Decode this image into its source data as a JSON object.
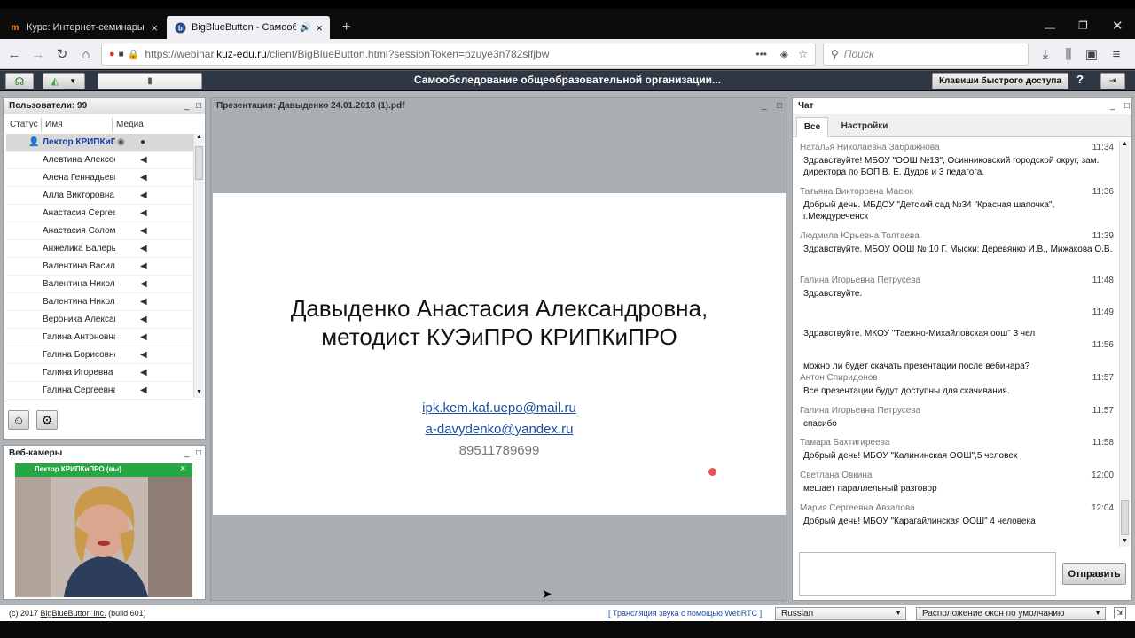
{
  "browser": {
    "tabs": [
      {
        "label": "Курс: Интернет-семинары КР",
        "icon": "moodle-icon",
        "active": false
      },
      {
        "label": "BigBlueButton - Самообсл",
        "icon": "bigbluebutton-icon",
        "active": true
      }
    ],
    "url_prefix": "https://webinar.",
    "url_domain": "kuz-edu.ru",
    "url_path": "/client/BigBlueButton.html?sessionToken=pzuye3n782slfjbw",
    "search_placeholder": "Поиск"
  },
  "app": {
    "title": "Самообследование общеобразовательной организации...",
    "shortcut_button": "Клавиши быстрого доступа",
    "help": "?"
  },
  "users": {
    "header": "Пользователи: 99",
    "columns": [
      "Статус",
      "Имя",
      "Медиа"
    ],
    "rows": [
      {
        "name": "Лектор КРИПКиПРО",
        "presenter": true
      },
      {
        "name": "Алевтина Алексеевна"
      },
      {
        "name": "Алена Геннадьевна"
      },
      {
        "name": "Алла Викторовна"
      },
      {
        "name": "Анастасия Сергеевна"
      },
      {
        "name": "Анастасия Соломоновна"
      },
      {
        "name": "Анжелика Валерьевна"
      },
      {
        "name": "Валентина Васильевна"
      },
      {
        "name": "Валентина Николаевна"
      },
      {
        "name": "Валентина Николаевна"
      },
      {
        "name": "Вероника Александровна"
      },
      {
        "name": "Галина Антоновна"
      },
      {
        "name": "Галина Борисовна"
      },
      {
        "name": "Галина Игоревна"
      },
      {
        "name": "Галина Сергеевна"
      }
    ]
  },
  "webcams": {
    "header": "Веб-камеры",
    "cam_label": "Лектор КРИПКиПРО (вы)"
  },
  "presentation": {
    "header": "Презентация: Давыденко 24.01.2018 (1).pdf",
    "line1": "Давыденко Анастасия Александровна,",
    "line2": "методист КУЭиПРО КРИПКиПРО",
    "email1": "ipk.kem.kaf.uepo@mail.ru",
    "email2": "a-davydenko@yandex.ru",
    "phone": "89511789699"
  },
  "chat": {
    "header": "Чат",
    "tabs": [
      "Все",
      "Настройки"
    ],
    "messages": [
      {
        "who": "Наталья Николаевна Забражнова",
        "time": "11:34",
        "text": "Здравствуйте! МБОУ \"ООШ №13\", Осинниковский городской округ, зам. директора по БОП В. Е. Дудов и 3 педагога."
      },
      {
        "who": "Татьяна Викторовна Масюк",
        "time": "11:36",
        "text": "Добрый день. МБДОУ \"Детский сад №34 \"Красная шапочка\", г.Междуреченск"
      },
      {
        "who": "Людмила Юрьевна Толтаева",
        "time": "11:39",
        "text": "Здравствуйте. МБОУ ООШ № 10 Г. Мыски: Деревянко И.В., Мижакова О.В."
      },
      {
        "who": "Галина Игорьевна Петрусева",
        "time": "11:48",
        "text": "Здравствуйте."
      },
      {
        "who": "",
        "time": "11:49",
        "text": "Здравствуйте. МКОУ \"Таежно-Михайловская оош\" 3 чел"
      },
      {
        "who": "",
        "time": "11:56",
        "text": "можно ли будет скачать презентации после вебинара?"
      },
      {
        "who": "Антон Спиридонов",
        "time": "11:57",
        "text": "Все презентации будут доступны для скачивания."
      },
      {
        "who": "Галина Игорьевна Петрусева",
        "time": "11:57",
        "text": "спасибо"
      },
      {
        "who": "Тамара Бахтигиреева",
        "time": "11:58",
        "text": "Добрый день! МБОУ \"Калининская ООШ\",5 человек"
      },
      {
        "who": "Светлана Овкина",
        "time": "12:00",
        "text": "мешает параллельный разговор"
      },
      {
        "who": "Мария Сергеевна Авзалова",
        "time": "12:04",
        "text": "Добрый день! МБОУ \"Карагайлинская ООШ\" 4 человека"
      }
    ],
    "send_button": "Отправить"
  },
  "footer": {
    "copyright_prefix": "(c) 2017 ",
    "copyright_link": "BigBlueButton Inc.",
    "copyright_suffix": " (build 601)",
    "webrtc": "[ Трансляция звука с помощью WebRTC ]",
    "language": "Russian",
    "layout": "Расположение окон по умолчанию"
  },
  "colors": {
    "appbar": "#2f3644",
    "webcam_label": "#26a744",
    "link": "#1a4fa0"
  }
}
